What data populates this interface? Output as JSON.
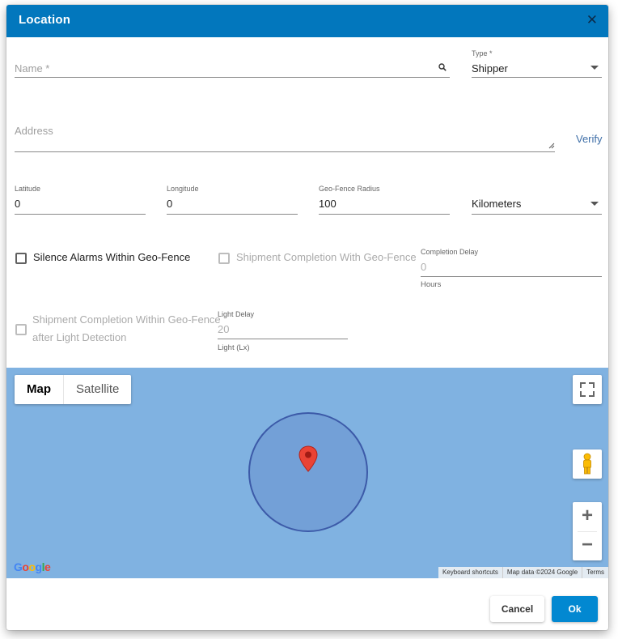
{
  "dialog": {
    "title": "Location",
    "close_glyph": "✕"
  },
  "form": {
    "name": {
      "placeholder": "Name *",
      "icon": "search-icon"
    },
    "type": {
      "label": "Type *",
      "value": "Shipper"
    },
    "address": {
      "placeholder": "Address",
      "verify_label": "Verify"
    },
    "latitude": {
      "label": "Latitude",
      "value": "0"
    },
    "longitude": {
      "label": "Longitude",
      "value": "0"
    },
    "radius": {
      "label": "Geo-Fence Radius",
      "value": "100"
    },
    "unit": {
      "value": "Kilometers"
    },
    "silence_alarms": {
      "label": "Silence Alarms Within Geo-Fence",
      "checked": false
    },
    "shipment_completion": {
      "label": "Shipment Completion With Geo-Fence",
      "checked": false,
      "disabled": true
    },
    "completion_delay": {
      "label": "Completion Delay",
      "value": "0",
      "helper": "Hours"
    },
    "light_completion": {
      "label_line1": "Shipment Completion Within Geo-Fence",
      "label_line2": "after Light Detection",
      "checked": false,
      "disabled": true
    },
    "light_delay": {
      "label": "Light Delay",
      "value": "20",
      "helper": "Light (Lx)"
    }
  },
  "map": {
    "map_type_map": "Map",
    "map_type_satellite": "Satellite",
    "logo_text": "Google",
    "attribution": [
      "Keyboard shortcuts",
      "Map data ©2024 Google",
      "Terms"
    ],
    "water_color": "#80b2e1",
    "fence_color": "#73a0d7",
    "marker_color": "#ea4335"
  },
  "footer": {
    "cancel_label": "Cancel",
    "ok_label": "Ok"
  }
}
